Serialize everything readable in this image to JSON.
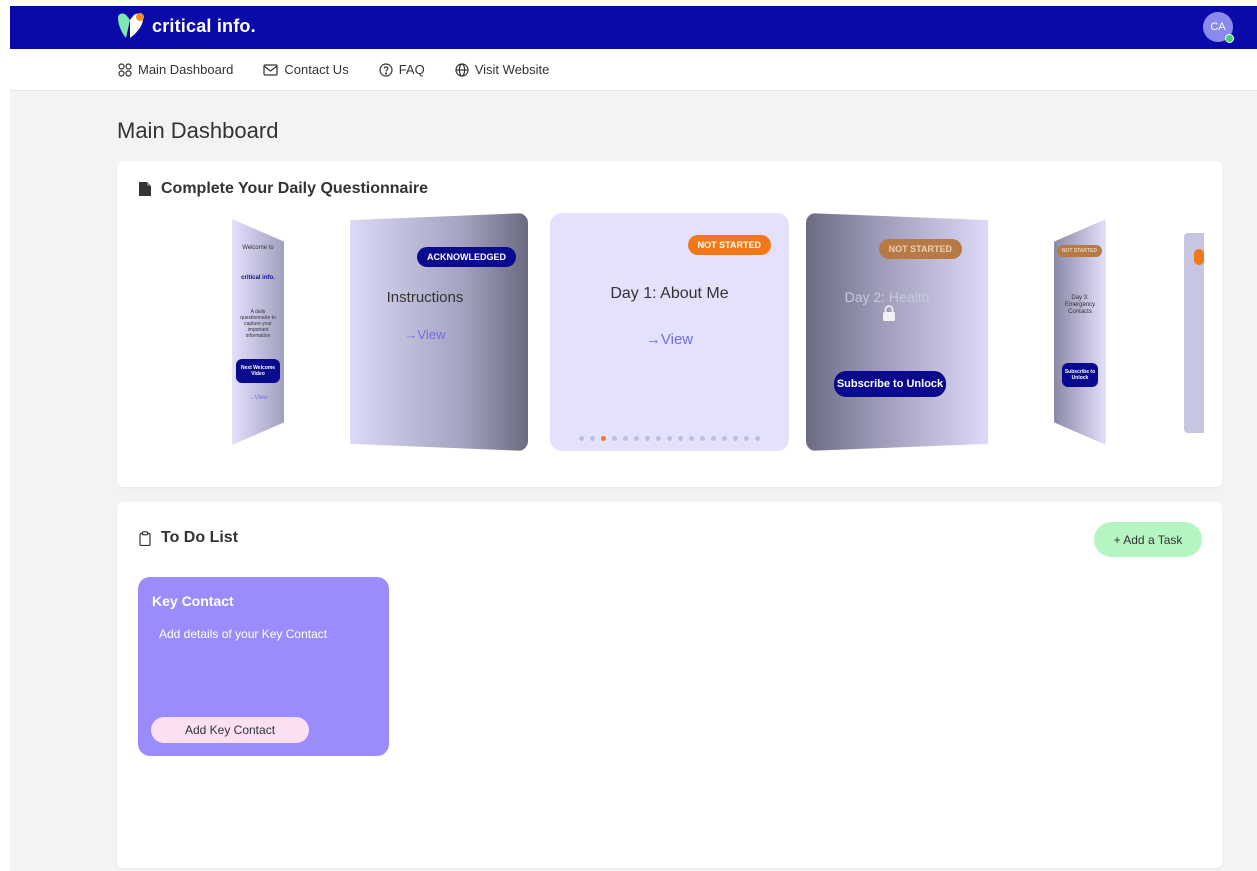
{
  "app": {
    "logo_text": "critical info.",
    "avatar_initials": "CA",
    "brand_color": "#0a0aa8"
  },
  "nav": {
    "items": [
      {
        "label": "Main Dashboard",
        "icon": "grid-icon"
      },
      {
        "label": "Contact Us",
        "icon": "mail-icon"
      },
      {
        "label": "FAQ",
        "icon": "question-icon"
      },
      {
        "label": "Visit Website",
        "icon": "globe-icon"
      }
    ]
  },
  "page": {
    "title": "Main Dashboard"
  },
  "questionnaire": {
    "heading": "Complete Your Daily Questionnaire",
    "welcome": {
      "title": "Welcome to",
      "brand": "critical info.",
      "body": "A daily questionnaire to capture your important information",
      "button": "Next Welcome Video",
      "link": "→View"
    },
    "instructions": {
      "badge": "Acknowledged",
      "title": "Instructions",
      "link": "→View"
    },
    "day1": {
      "badge": "NOT STARTED",
      "title": "Day 1: About Me",
      "link": "→View"
    },
    "day2": {
      "badge": "NOT STARTED",
      "title": "Day 2: Health",
      "button": "Subscribe to Unlock"
    },
    "day3": {
      "badge": "NOT STARTED",
      "title": "Day 3: Emergency Contacts",
      "button": "Subscribe to Unlock"
    },
    "carousel_total": 17,
    "carousel_active": 3
  },
  "todo": {
    "heading": "To Do List",
    "add_button": "+ Add a Task",
    "tasks": [
      {
        "title": "Key Contact",
        "description": "Add details of your Key Contact",
        "button": "Add Key Contact"
      }
    ]
  }
}
